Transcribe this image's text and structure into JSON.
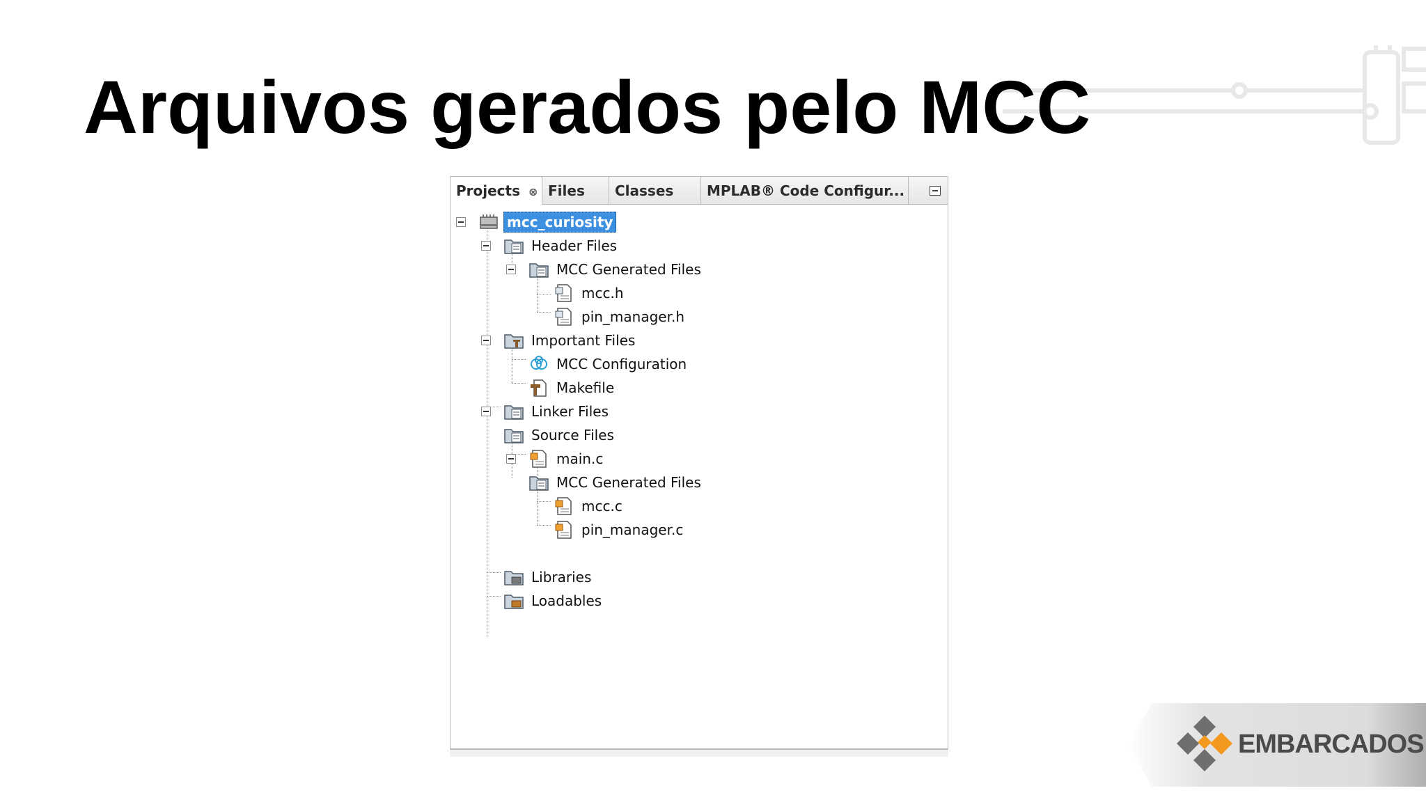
{
  "slide": {
    "title": "Arquivos gerados pelo MCC"
  },
  "panel": {
    "tabs": [
      {
        "label": "Projects",
        "close": "⊗"
      },
      {
        "label": "Files"
      },
      {
        "label": "Classes"
      },
      {
        "label": "MPLAB® Code Configur..."
      }
    ],
    "tree": {
      "root": "mcc_curiosity",
      "header_files": "Header Files",
      "header_mcc_generated": "MCC Generated Files",
      "mcc_h": "mcc.h",
      "pin_manager_h": "pin_manager.h",
      "important_files": "Important Files",
      "mcc_configuration": "MCC Configuration",
      "makefile": "Makefile",
      "linker_files": "Linker Files",
      "source_files": "Source Files",
      "main_c": "main.c",
      "source_mcc_generated": "MCC Generated Files",
      "mcc_c": "mcc.c",
      "pin_manager_c": "pin_manager.c",
      "libraries": "Libraries",
      "loadables": "Loadables"
    }
  },
  "logo": {
    "text": "EMBARCADOS"
  },
  "colors": {
    "selection": "#3d8fe0",
    "logo_orange": "#f39a1e",
    "logo_gray": "#6e6e6e"
  }
}
